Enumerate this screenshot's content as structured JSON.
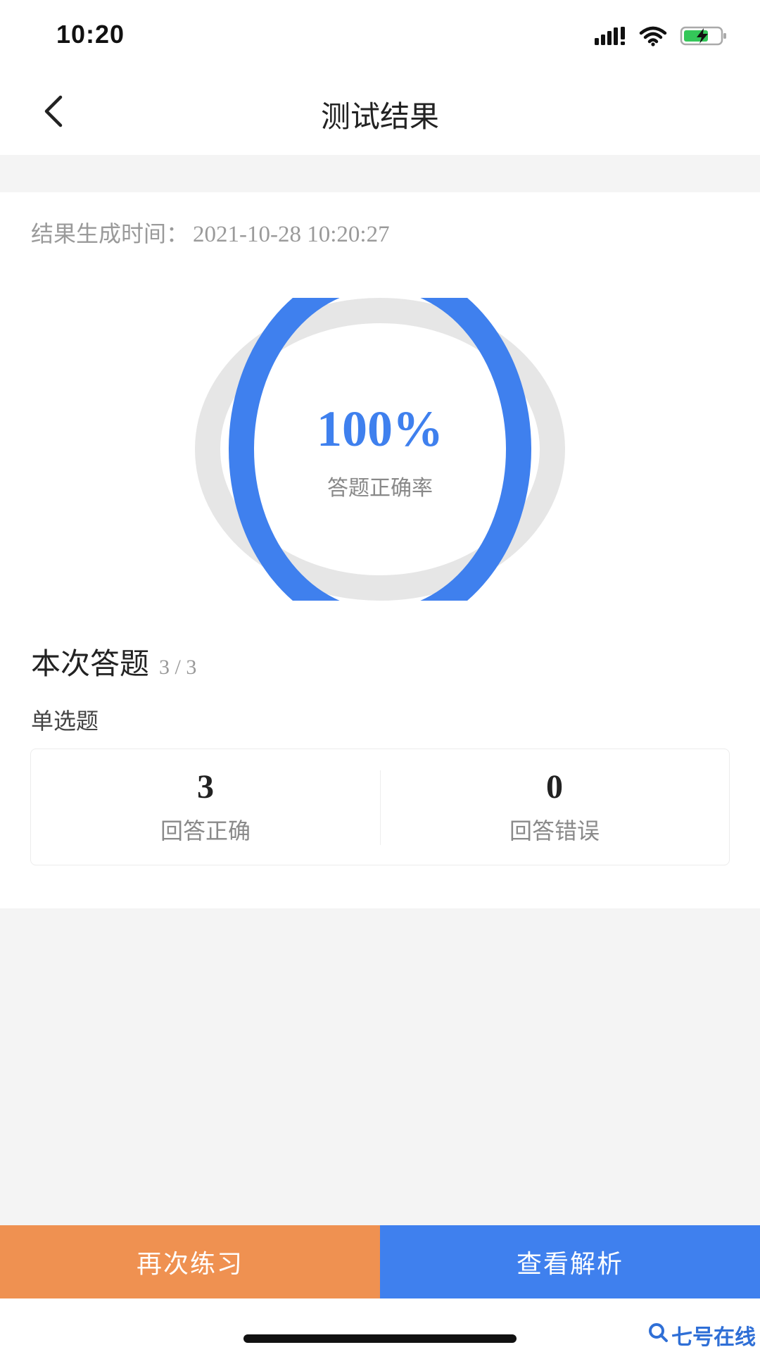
{
  "status_bar": {
    "time": "10:20",
    "icons": [
      "signal-icon",
      "wifi-icon",
      "battery-charging-icon"
    ]
  },
  "nav": {
    "back_icon": "chevron-left-icon",
    "title": "测试结果"
  },
  "result": {
    "generated_label": "结果生成时间：",
    "generated_time": "2021-10-28 10:20:27",
    "accuracy_text": "100%",
    "accuracy_value": 1.0,
    "accuracy_label": "答题正确率",
    "ring_color": "#3f80ee"
  },
  "session": {
    "title": "本次答题",
    "count": "3 / 3",
    "category": "单选题",
    "stats": [
      {
        "value": "3",
        "label": "回答正确"
      },
      {
        "value": "0",
        "label": "回答错误"
      }
    ]
  },
  "actions": {
    "retry_label": "再次练习",
    "analysis_label": "查看解析",
    "retry_color": "#ef9151",
    "analysis_color": "#3f80ee"
  },
  "watermark": {
    "text": "七号在线",
    "icon": "search-logo-icon"
  }
}
